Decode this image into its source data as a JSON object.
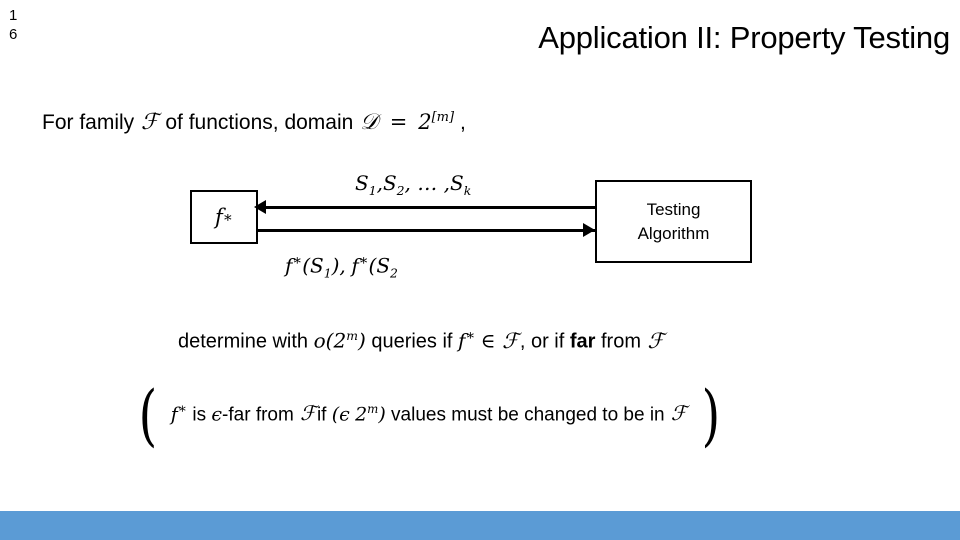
{
  "slide": {
    "number_digits": [
      "1",
      "6"
    ],
    "title": "Application II: Property Testing",
    "background_color": "#FFFFFF",
    "accent_bar_color": "#5B9BD5"
  },
  "line_family": {
    "prefix": "For family",
    "family_symbol": "ℱ",
    "mid": "of functions, domain",
    "domain_symbol": "𝒟",
    "equals": "=",
    "base": "2",
    "exponent": "[m]",
    "comma": ","
  },
  "diagram": {
    "function_box": {
      "label_f": "f",
      "label_star": "∗"
    },
    "algorithm_box": {
      "line1": "Testing",
      "line2": "Algorithm"
    },
    "query_label": {
      "s1": "S",
      "s1_sub": "1",
      "sep1": ",",
      "s2": "S",
      "s2_sub": "2",
      "sep2": ", … ,",
      "sk": "S",
      "sk_sub": "k"
    },
    "answer_label": {
      "f1": "f",
      "star1": "∗",
      "open1": "(S",
      "sub1": "1",
      "close1": "),",
      "f2": "f",
      "star2": "∗",
      "open2": "(S",
      "sub2": "2"
    },
    "arrow_top_direction": "left",
    "arrow_bottom_direction": "right"
  },
  "line_determine": {
    "t1": "determine with",
    "o_sym": "o",
    "paren_open": "(2",
    "exp_m": "m",
    "paren_close": ")",
    "t2": "queries if",
    "f_sym": "f",
    "star": "∗",
    "in_sym": "∈",
    "family_symbol": "ℱ",
    "t3": ", or if",
    "far": "far",
    "t4": "from",
    "family_symbol2": "ℱ"
  },
  "line_bracket": {
    "paren_open": "(",
    "f_sym": "f",
    "star": "∗",
    "t1": "is",
    "epsilon": "ϵ",
    "t2": "-far from",
    "family_symbol": "ℱ",
    "t3": "if",
    "inner_open": "(",
    "epsilon2": "ϵ",
    "base": "2",
    "exp_m": "m",
    "inner_close": ")",
    "t4": "values must be changed to be in",
    "family_symbol2": "ℱ",
    "paren_close": ")"
  }
}
